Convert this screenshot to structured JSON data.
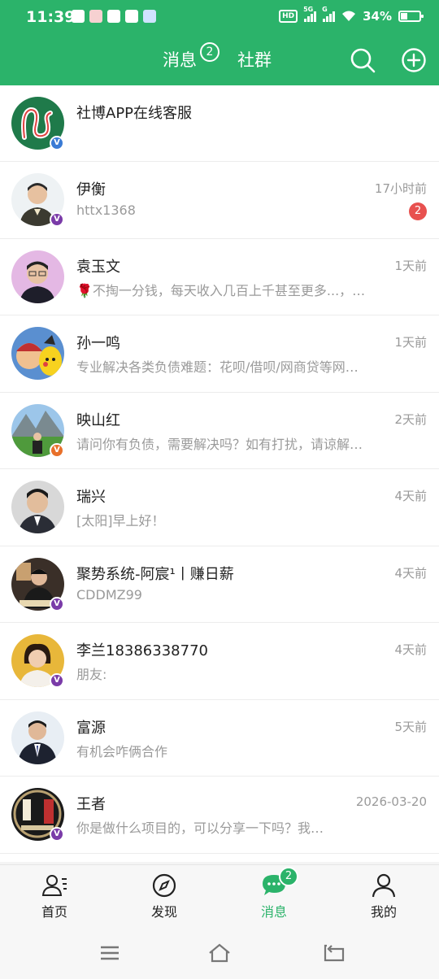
{
  "status_bar": {
    "time": "11:39",
    "hd_label": "HD",
    "network1": "5G",
    "network2": "G",
    "battery": "34%"
  },
  "header": {
    "tab_messages": "消息",
    "tab_messages_badge": "2",
    "tab_groups": "社群"
  },
  "messages": [
    {
      "name": "社博APP在线客服",
      "preview": "",
      "time": "",
      "unread": "",
      "badge": "blue",
      "avatar": "logo"
    },
    {
      "name": "伊衡",
      "preview": "httx1368",
      "time": "17小时前",
      "unread": "2",
      "badge": "purple",
      "avatar": "man-light"
    },
    {
      "name": "袁玉文",
      "preview": "🌹不掏一分钱，每天收入几百上千甚至更多...，…",
      "time": "1天前",
      "unread": "",
      "badge": "",
      "avatar": "man-pink"
    },
    {
      "name": "孙一鸣",
      "preview": "专业解决各类负债难题：花呗/借呗/网商贷等网…",
      "time": "1天前",
      "unread": "",
      "badge": "",
      "avatar": "cartoon"
    },
    {
      "name": "映山红",
      "preview": "请问你有负债，需要解决吗？如有打扰，请谅解…",
      "time": "2天前",
      "unread": "",
      "badge": "orange",
      "avatar": "mountain"
    },
    {
      "name": "瑞兴",
      "preview": "[太阳]早上好！",
      "time": "4天前",
      "unread": "",
      "badge": "",
      "avatar": "man-grey"
    },
    {
      "name": "聚势系统-阿宸¹丨赚日薪",
      "preview": "CDDMZ99",
      "time": "4天前",
      "unread": "",
      "badge": "purple",
      "avatar": "man-dark"
    },
    {
      "name": "李兰18386338770",
      "preview": "朋友:",
      "time": "4天前",
      "unread": "",
      "badge": "purple",
      "avatar": "woman-yellow"
    },
    {
      "name": "富源",
      "preview": "有机会咋俩合作",
      "time": "5天前",
      "unread": "",
      "badge": "",
      "avatar": "man-suit"
    },
    {
      "name": "王者",
      "preview": "你是做什么项目的，可以分享一下吗？我…",
      "time": "2026-03-20",
      "unread": "",
      "badge": "purple",
      "avatar": "king"
    }
  ],
  "bottom_nav": {
    "home": "首页",
    "discover": "发现",
    "messages": "消息",
    "messages_badge": "2",
    "mine": "我的"
  },
  "colors": {
    "brand_green": "#2bb36a",
    "unread_red": "#e8514f"
  }
}
